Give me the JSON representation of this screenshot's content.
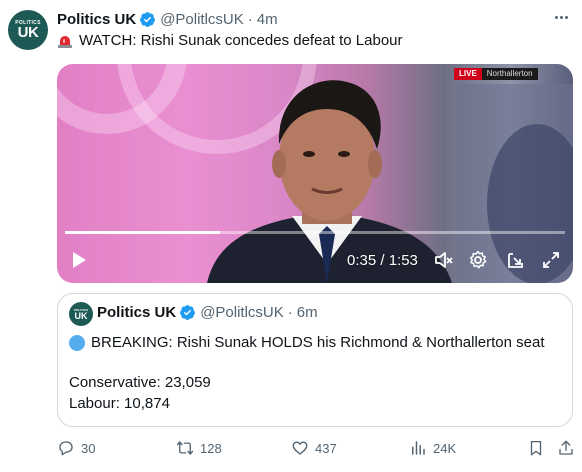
{
  "tweet": {
    "author": {
      "name": "Politics UK",
      "handle": "@PolitlcsUK",
      "avatar_top": "POLITICS",
      "avatar_main": "UK",
      "avatar_color": "#1d5a56"
    },
    "separator": "·",
    "time": "4m",
    "text": "WATCH: Rishi Sunak concedes defeat to Labour",
    "text_emoji": "rotating-light-icon"
  },
  "video": {
    "live_label": "LIVE",
    "location_label": "Northallerton",
    "current_time": "0:35",
    "duration": "1:53",
    "timecode": "0:35 / 1:53",
    "progress_fraction": 0.31
  },
  "quoted_tweet": {
    "author": {
      "name": "Politics UK",
      "handle": "@PolitlcsUK"
    },
    "separator": "·",
    "time": "6m",
    "breaking_text": "BREAKING: Rishi Sunak HOLDS his Richmond & Northallerton seat",
    "breaking_emoji": "blue-circle-icon",
    "result_conservative": "Conservative: 23,059",
    "result_labour": "Labour: 10,874"
  },
  "actions": {
    "replies": "30",
    "retweets": "128",
    "likes": "437",
    "views": "24K"
  },
  "colors": {
    "verified_blue": "#1d9bf0",
    "muted_text": "#536471",
    "live_red": "#d0021b"
  }
}
